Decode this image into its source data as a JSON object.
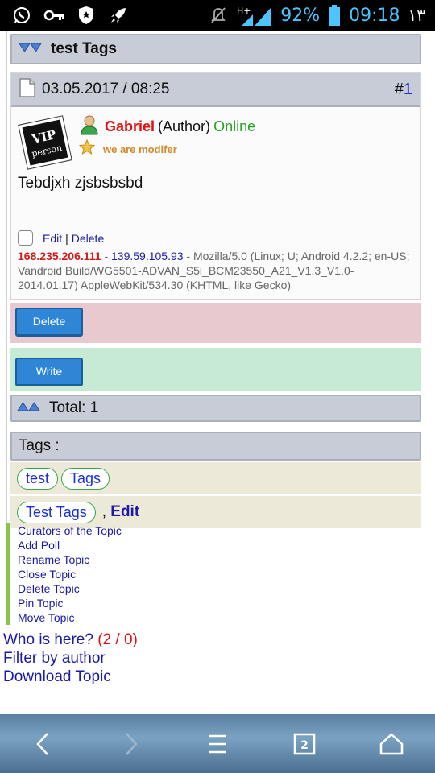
{
  "status_bar": {
    "battery_percent": "92%",
    "time": "09:18",
    "day": "١٣",
    "network": "H+"
  },
  "topic": {
    "title": "test Tags"
  },
  "post": {
    "date": "03.05.2017 / 08:25",
    "number_prefix": "#",
    "number": "1",
    "author_name": "Gabriel",
    "author_role": "(Author)",
    "online": "Online",
    "status_text": "we are modifer",
    "avatar_text_top": "VIP",
    "avatar_text_bottom": "person",
    "message": "Tebdjxh zjsbsbsbd",
    "edit_label": "Edit",
    "separator": "|",
    "delete_label": "Delete",
    "ip_primary": "168.235.206.111",
    "ip_dash": " - ",
    "ip_secondary": "139.59.105.93",
    "user_agent": " - Mozilla/5.0 (Linux; U; Android 4.2.2; en-US; Vandroid Build/WG5501-ADVAN_S5i_BCM23550_A21_V1.3_V1.0-2014.01.17) AppleWebKit/534.30 (KHTML, like Gecko)"
  },
  "buttons": {
    "delete": "Delete",
    "write": "Write"
  },
  "total": {
    "label": "Total: 1"
  },
  "tags": {
    "header": "Tags :",
    "list": [
      "test",
      "Tags"
    ],
    "combined": "Test Tags",
    "edit_prefix": ", ",
    "edit_label": "Edit"
  },
  "tools": [
    "Curators of the Topic",
    "Add Poll",
    "Rename Topic",
    "Close Topic",
    "Delete Topic",
    "Pin Topic",
    "Move Topic"
  ],
  "links": {
    "who_here": "Who is here?",
    "who_count": "(2 / 0)",
    "filter": "Filter by author",
    "download": "Download Topic"
  },
  "navbar": {
    "tabs_count": "2"
  },
  "colors": {
    "bar_bg": "#c7ccd6",
    "delete_area": "#e8c9d0",
    "write_area": "#c7ead5",
    "tag_row": "#ece9d8",
    "button": "#2f86d6",
    "link": "#1a1aa6"
  }
}
